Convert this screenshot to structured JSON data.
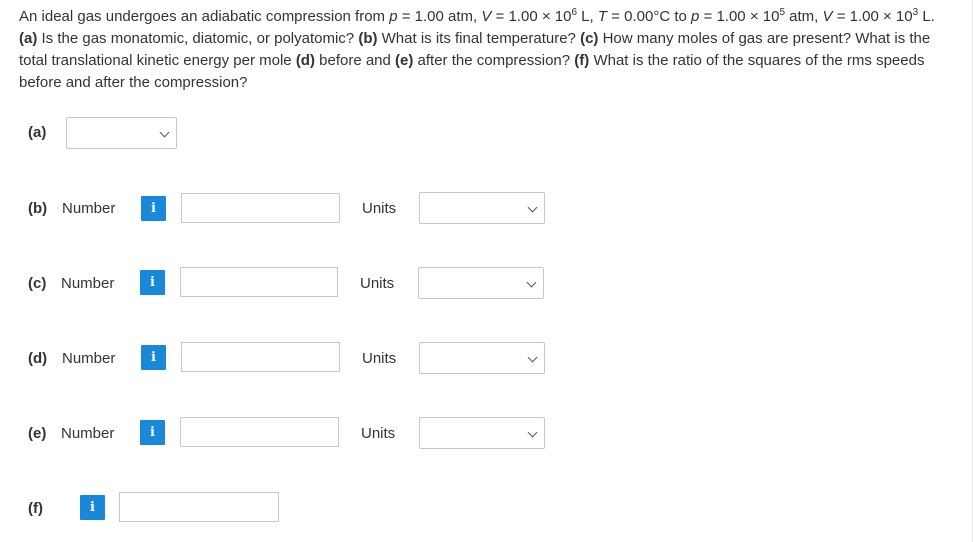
{
  "question": {
    "intro": "An ideal gas undergoes an adiabatic compression from ",
    "p1_var": "p",
    "p1_val": " = 1.00 atm, ",
    "v1_var": "V",
    "v1_val": " = 1.00 × 10",
    "v1_exp": "6",
    "v1_unit": " L, ",
    "t1_var": "T",
    "t1_val": " = 0.00°C to ",
    "p2_var": "p",
    "p2_val": " = 1.00 × 10",
    "p2_exp": "5",
    "p2_unit": " atm, ",
    "v2_var": "V",
    "v2_val": " = 1.00 × 10",
    "v2_exp": "3",
    "v2_unit": " L.",
    "a_tag": "(a)",
    "a_text": " Is the gas monatomic, diatomic, or polyatomic? ",
    "b_tag": "(b)",
    "b_text": " What is its final temperature? ",
    "c_tag": "(c)",
    "c_text": " How many moles of gas are present? What is the total translational kinetic energy per mole ",
    "d_tag": "(d)",
    "d_text": " before and ",
    "e_tag": "(e)",
    "e_text": " after the compression? ",
    "f_tag": "(f)",
    "f_text": " What is the ratio of the squares of the rms speeds before and after the compression?"
  },
  "parts": {
    "a": {
      "label": "(a)"
    },
    "b": {
      "label": "(b)",
      "number_label": "Number",
      "units_label": "Units",
      "info": "i"
    },
    "c": {
      "label": "(c)",
      "number_label": "Number",
      "units_label": "Units",
      "info": "i"
    },
    "d": {
      "label": "(d)",
      "number_label": "Number",
      "units_label": "Units",
      "info": "i"
    },
    "e": {
      "label": "(e)",
      "number_label": "Number",
      "units_label": "Units",
      "info": "i"
    },
    "f": {
      "label": "(f)",
      "info": "i"
    }
  },
  "colors": {
    "info_button": "#1a88d8",
    "border": "#c7c7c7",
    "text": "#333333"
  },
  "icons": {
    "info": "info-icon",
    "dropdown": "chevron-down-icon"
  }
}
